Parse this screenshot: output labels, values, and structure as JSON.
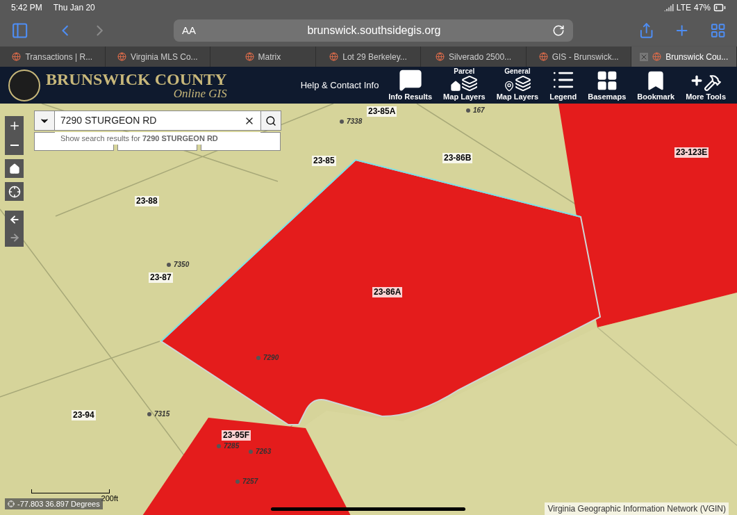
{
  "status_bar": {
    "time": "5:42 PM",
    "date": "Thu Jan 20",
    "network": "LTE",
    "battery": "47%"
  },
  "toolbar": {
    "text_size": "AA",
    "url": "brunswick.southsidegis.org"
  },
  "tabs": [
    {
      "label": "Transactions | R...",
      "selected": false
    },
    {
      "label": "Virginia MLS Co...",
      "selected": false
    },
    {
      "label": "Matrix",
      "selected": false
    },
    {
      "label": "Lot 29 Berkeley...",
      "selected": false
    },
    {
      "label": "Silverado 2500...",
      "selected": false
    },
    {
      "label": "GIS - Brunswick...",
      "selected": false
    },
    {
      "label": "Brunswick Cou...",
      "selected": true
    }
  ],
  "header": {
    "title": "BRUNSWICK COUNTY",
    "subtitle": "Online GIS",
    "help_link": "Help & Contact Info",
    "tools": [
      {
        "kind": "info",
        "label": "Info Results"
      },
      {
        "kind": "parcel",
        "top": "Parcel",
        "label": "Map Layers"
      },
      {
        "kind": "general",
        "top": "General",
        "label": "Map Layers"
      },
      {
        "kind": "legend",
        "label": "Legend"
      },
      {
        "kind": "basemaps",
        "label": "Basemaps"
      },
      {
        "kind": "bookmark",
        "label": "Bookmark"
      },
      {
        "kind": "tools",
        "label": "More Tools"
      }
    ]
  },
  "search": {
    "value": "7290 STURGEON RD",
    "suggestion": "Show search results for **7290 STURGEON RD**"
  },
  "map": {
    "parcels": [
      "23-85A",
      "23-85",
      "23-86B",
      "23-123E",
      "23-88",
      "23-87",
      "23-86A",
      "23-94",
      "23-95F"
    ],
    "addresses": [
      "7338",
      "167",
      "7350",
      "7290",
      "7315",
      "7285",
      "7263",
      "7257"
    ],
    "scale": "200ft",
    "coordinates": "-77.803 36.897 Degrees",
    "attribution": "Virginia Geographic Information Network (VGIN)"
  }
}
